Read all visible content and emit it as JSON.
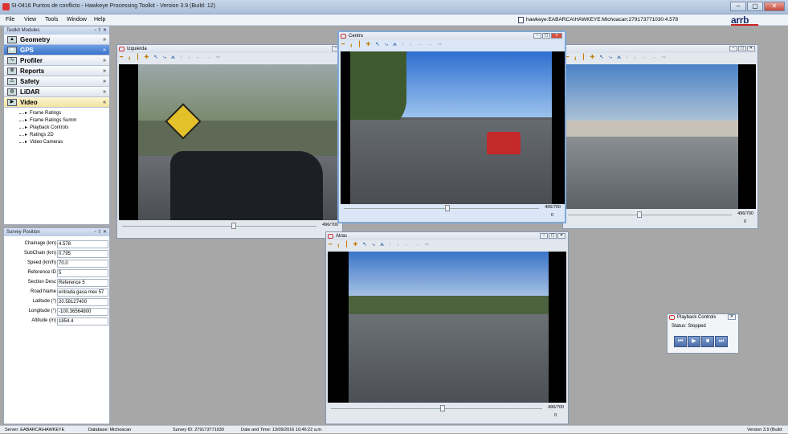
{
  "window": {
    "title": "SI-0416 Puntos de conflicto - Hawkeye Processing Toolkit - Version 3.9 (Build: 12)",
    "controls": [
      "–",
      "▢",
      "✕"
    ]
  },
  "menu": [
    "File",
    "View",
    "Tools",
    "Window",
    "Help"
  ],
  "path": "hawkeye:EABARCA\\HAWKEYE:Michoacan:279173771030:4.578",
  "logo": "arrb",
  "toolkit": {
    "title": "Toolkit Modules",
    "controls": "▫ ⇧ ✕",
    "modules": [
      {
        "label": "Geometry",
        "icon": "▲",
        "chev": "»"
      },
      {
        "label": "GPS",
        "icon": "◉",
        "chev": "»"
      },
      {
        "label": "Profiler",
        "icon": "∿",
        "chev": "»"
      },
      {
        "label": "Reports",
        "icon": "≣",
        "chev": "»"
      },
      {
        "label": "Safety",
        "icon": "⚠",
        "chev": "»"
      },
      {
        "label": "LiDAR",
        "icon": "◍",
        "chev": "»"
      },
      {
        "label": "Video",
        "icon": "▶",
        "chev": "«"
      }
    ],
    "video_items": [
      "Frame Ratings",
      "Frame Ratings Summ",
      "Playback Controls",
      "Ratings 2D",
      "Video Cameras"
    ]
  },
  "survey": {
    "title": "Survey Position",
    "controls": "▫ ⇧ ✕",
    "rows": [
      {
        "label": "Chainage (km)",
        "value": "4.578"
      },
      {
        "label": "SubChain (km)",
        "value": "0.795"
      },
      {
        "label": "Speed (km/h)",
        "value": "70.0"
      },
      {
        "label": "Reference ID",
        "value": "5"
      },
      {
        "label": "Section Desc",
        "value": "Reference 5"
      },
      {
        "label": "Road Name",
        "value": "entrada gasa mex 57"
      },
      {
        "label": "Latitude (°)",
        "value": "20.58127400"
      },
      {
        "label": "Longitude (°)",
        "value": "-100.36564800"
      },
      {
        "label": "Altitude (m)",
        "value": "1854.4"
      }
    ]
  },
  "windows": {
    "izquierda": {
      "title": "Izquierda",
      "frame": "496/700",
      "zero": "0"
    },
    "centro": {
      "title": "Centro",
      "frame": "496/700",
      "zero": "0"
    },
    "derecha": {
      "title": "",
      "frame": "496/700",
      "zero": "0"
    },
    "atras": {
      "title": "Atras",
      "frame": "496/700",
      "zero": "0"
    }
  },
  "toolbar_glyphs": {
    "orange": "━ ╻ ┃ ✚",
    "blue": "↖ ⤷ ⩕",
    "gray": "↑ ↓ ← → ⇨"
  },
  "playback": {
    "title": "Playback Controls",
    "status": "Status:  Stopped",
    "buttons": [
      "⏮",
      "▶",
      "■",
      "⏭"
    ]
  },
  "statusbar": {
    "server": "Server: EABARCA\\HAWKEYE",
    "database": "Database: Michoacan",
    "survey_id": "Survey ID: 279173771030",
    "datetime": "Date and Time: 13/09/2016 10:46:22 a.m.",
    "version": "Version 3.9 (Build:"
  },
  "colors": {
    "accent": "#3a72c8",
    "active_module": "#fdf6d0",
    "background": "#a7a7a7"
  }
}
